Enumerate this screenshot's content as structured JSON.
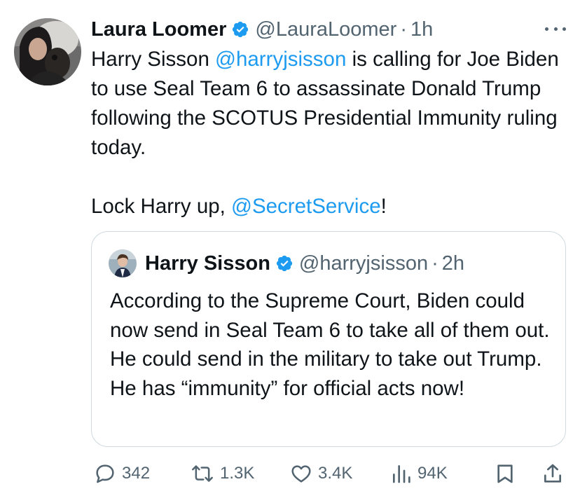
{
  "tweet": {
    "author_name": "Laura Loomer",
    "author_handle": "@LauraLoomer",
    "separator": "·",
    "time": "1h",
    "text_line1_a": "Harry Sisson ",
    "text_mention1": "@harryjsisson",
    "text_line1_b": " is calling for Joe Biden to use Seal Team 6 to assassinate Donald Trump following the SCOTUS Presidential Immunity ruling today.",
    "text_line2_a": "Lock Harry up, ",
    "text_mention2": "@SecretService",
    "text_line2_b": "!"
  },
  "quote": {
    "author_name": "Harry Sisson",
    "author_handle": "@harryjsisson",
    "separator": "·",
    "time": "2h",
    "text": "According to the Supreme Court, Biden could now send in Seal Team 6 to take all of them out. He could send in the military to take out Trump. He has “immunity” for official acts now!"
  },
  "actions": {
    "replies": "342",
    "reposts": "1.3K",
    "likes": "3.4K",
    "views": "94K"
  },
  "icons": {
    "verified": "verified-badge-icon",
    "more": "more-icon",
    "reply": "reply-icon",
    "repost": "repost-icon",
    "like": "heart-icon",
    "views": "views-icon",
    "bookmark": "bookmark-icon",
    "share": "share-icon"
  },
  "colors": {
    "accent": "#1d9bf0",
    "text": "#0f1419",
    "muted": "#536471",
    "border": "#cfd9de"
  }
}
